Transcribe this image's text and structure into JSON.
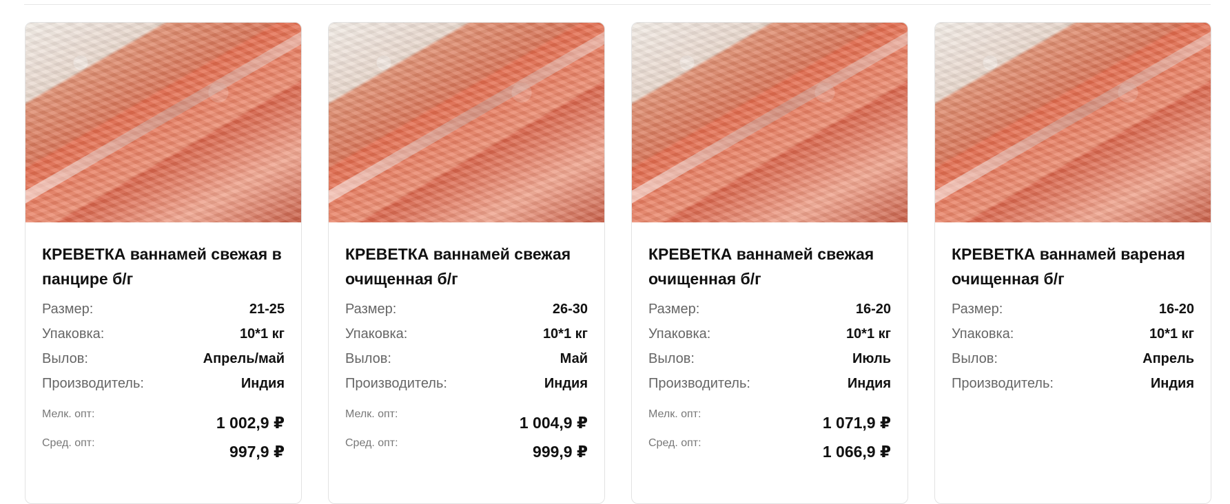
{
  "products": [
    {
      "title": "КРЕВЕТКА ваннамей свежая в панцире б/г",
      "specs": [
        {
          "label": "Размер:",
          "value": "21-25"
        },
        {
          "label": "Упаковка:",
          "value": "10*1 кг"
        },
        {
          "label": "Вылов:",
          "value": "Апрель/май"
        },
        {
          "label": "Производитель:",
          "value": "Индия"
        }
      ],
      "prices": [
        {
          "label": "Мелк. опт:",
          "value": "1 002,9 ₽"
        },
        {
          "label": "Сред. опт:",
          "value": "997,9 ₽"
        }
      ]
    },
    {
      "title": "КРЕВЕТКА ваннамей свежая очищенная б/г",
      "specs": [
        {
          "label": "Размер:",
          "value": "26-30"
        },
        {
          "label": "Упаковка:",
          "value": "10*1 кг"
        },
        {
          "label": "Вылов:",
          "value": "Май"
        },
        {
          "label": "Производитель:",
          "value": "Индия"
        }
      ],
      "prices": [
        {
          "label": "Мелк. опт:",
          "value": "1 004,9 ₽"
        },
        {
          "label": "Сред. опт:",
          "value": "999,9 ₽"
        }
      ]
    },
    {
      "title": "КРЕВЕТКА ваннамей свежая очищенная б/г",
      "specs": [
        {
          "label": "Размер:",
          "value": "16-20"
        },
        {
          "label": "Упаковка:",
          "value": "10*1 кг"
        },
        {
          "label": "Вылов:",
          "value": "Июль"
        },
        {
          "label": "Производитель:",
          "value": "Индия"
        }
      ],
      "prices": [
        {
          "label": "Мелк. опт:",
          "value": "1 071,9 ₽"
        },
        {
          "label": "Сред. опт:",
          "value": "1 066,9 ₽"
        }
      ]
    },
    {
      "title": "КРЕВЕТКА ваннамей вареная очищенная б/г",
      "specs": [
        {
          "label": "Размер:",
          "value": "16-20"
        },
        {
          "label": "Упаковка:",
          "value": "10*1 кг"
        },
        {
          "label": "Вылов:",
          "value": "Апрель"
        },
        {
          "label": "Производитель:",
          "value": "Индия"
        }
      ],
      "prices": []
    }
  ]
}
